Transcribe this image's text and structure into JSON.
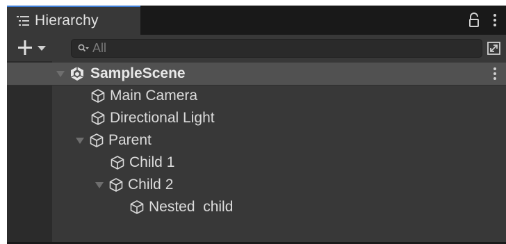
{
  "window": {
    "tab_title": "Hierarchy",
    "accent_color": "#3d7dd6"
  },
  "toolbar": {
    "search_placeholder": "All"
  },
  "icons": [
    "hierarchy-list-icon",
    "lock-icon",
    "kebab-menu-icon",
    "plus-icon",
    "dropdown-arrow-icon",
    "search-icon",
    "expand-window-icon",
    "unity-scene-icon",
    "gameobject-cube-icon",
    "foldout-arrow-icon"
  ],
  "tree": {
    "scene": {
      "label": "SampleScene",
      "expanded": true
    },
    "items": [
      {
        "label": "Main Camera",
        "depth": 1,
        "has_children": false
      },
      {
        "label": "Directional Light",
        "depth": 1,
        "has_children": false
      },
      {
        "label": "Parent",
        "depth": 1,
        "has_children": true,
        "expanded": true
      },
      {
        "label": "Child 1",
        "depth": 2,
        "has_children": false
      },
      {
        "label": "Child 2",
        "depth": 2,
        "has_children": true,
        "expanded": true
      },
      {
        "label": "Nested  child",
        "depth": 3,
        "has_children": false
      }
    ]
  }
}
